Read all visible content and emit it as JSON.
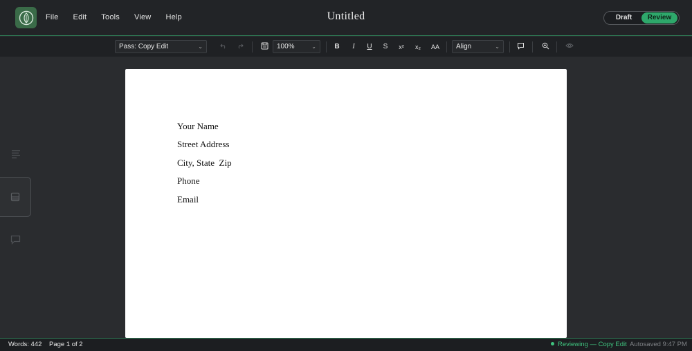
{
  "app": {
    "title": "Untitled",
    "menu": [
      "File",
      "Edit",
      "Tools",
      "View",
      "Help"
    ],
    "logo_icon": "leaf-icon"
  },
  "mode_toggle": {
    "draft_label": "Draft",
    "review_label": "Review",
    "active": "Review"
  },
  "toolbar": {
    "pass_select": "Pass: Copy Edit",
    "zoom_select": "100%",
    "align_select": "Align",
    "bold": "B",
    "italic": "I",
    "underline": "U",
    "strikethrough": "S",
    "superscript": "x²",
    "subscript": "x₂",
    "font_size": "AA",
    "icons": [
      "undo-icon",
      "redo-icon",
      "save-icon",
      "comment-icon",
      "zoom-in-icon",
      "eye-icon"
    ]
  },
  "sidebar": {
    "items": [
      {
        "icon": "outline-icon"
      },
      {
        "icon": "pages-icon",
        "active": true
      },
      {
        "icon": "comments-icon"
      }
    ]
  },
  "document": {
    "lines": [
      "Your Name",
      "Street Address",
      "City, State  Zip",
      "Phone",
      "Email"
    ]
  },
  "status": {
    "words": "Words: 442",
    "page": "Page 1 of 2",
    "review": "Reviewing — Copy Edit",
    "autosave": "Autosaved 9:47 PM"
  },
  "colors": {
    "accent": "#2ea86b",
    "background": "#2a2c2f",
    "topbar": "#222427"
  }
}
